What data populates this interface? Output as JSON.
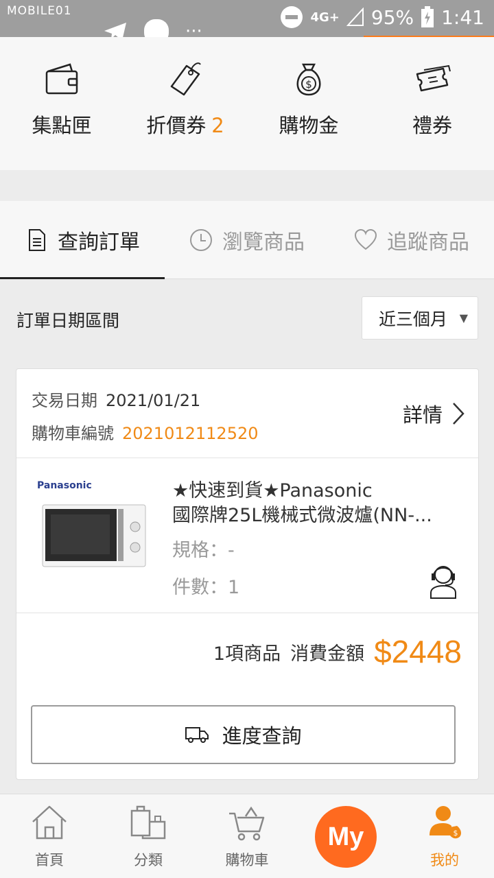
{
  "status_bar": {
    "watermark": "MOBILE01",
    "network": "4G+",
    "battery": "95%",
    "time": "1:41"
  },
  "wallet": {
    "items": [
      {
        "label": "集點匣",
        "icon": "wallet-icon"
      },
      {
        "label": "折價券",
        "count": "2",
        "icon": "coupon-tag-icon"
      },
      {
        "label": "購物金",
        "icon": "money-bag-icon"
      },
      {
        "label": "禮券",
        "icon": "ticket-icon"
      }
    ]
  },
  "tabs": [
    {
      "label": "查詢訂單",
      "icon": "document-icon",
      "active": true
    },
    {
      "label": "瀏覽商品",
      "icon": "clock-icon",
      "active": false
    },
    {
      "label": "追蹤商品",
      "icon": "heart-icon",
      "active": false
    }
  ],
  "filter": {
    "label": "訂單日期區間",
    "selected": "近三個月"
  },
  "order": {
    "date_label": "交易日期",
    "date": "2021/01/21",
    "cart_label": "購物車編號",
    "cart_no": "2021012112520",
    "detail_label": "詳情",
    "product": {
      "brand": "Panasonic",
      "name_line1": "★快速到貨★Panasonic",
      "name_line2": "國際牌25L機械式微波爐(NN-...",
      "spec": "規格：-",
      "qty": "件數：1"
    },
    "summary_count": "1項商品",
    "summary_label": "消費金額",
    "amount": "$2448",
    "track_label": "進度查詢"
  },
  "bottom_nav": {
    "home": "首頁",
    "category": "分類",
    "cart": "購物車",
    "my_button": "My",
    "mine": "我的"
  },
  "colors": {
    "accent": "#f08a16",
    "my_button": "#ff6a1f"
  }
}
